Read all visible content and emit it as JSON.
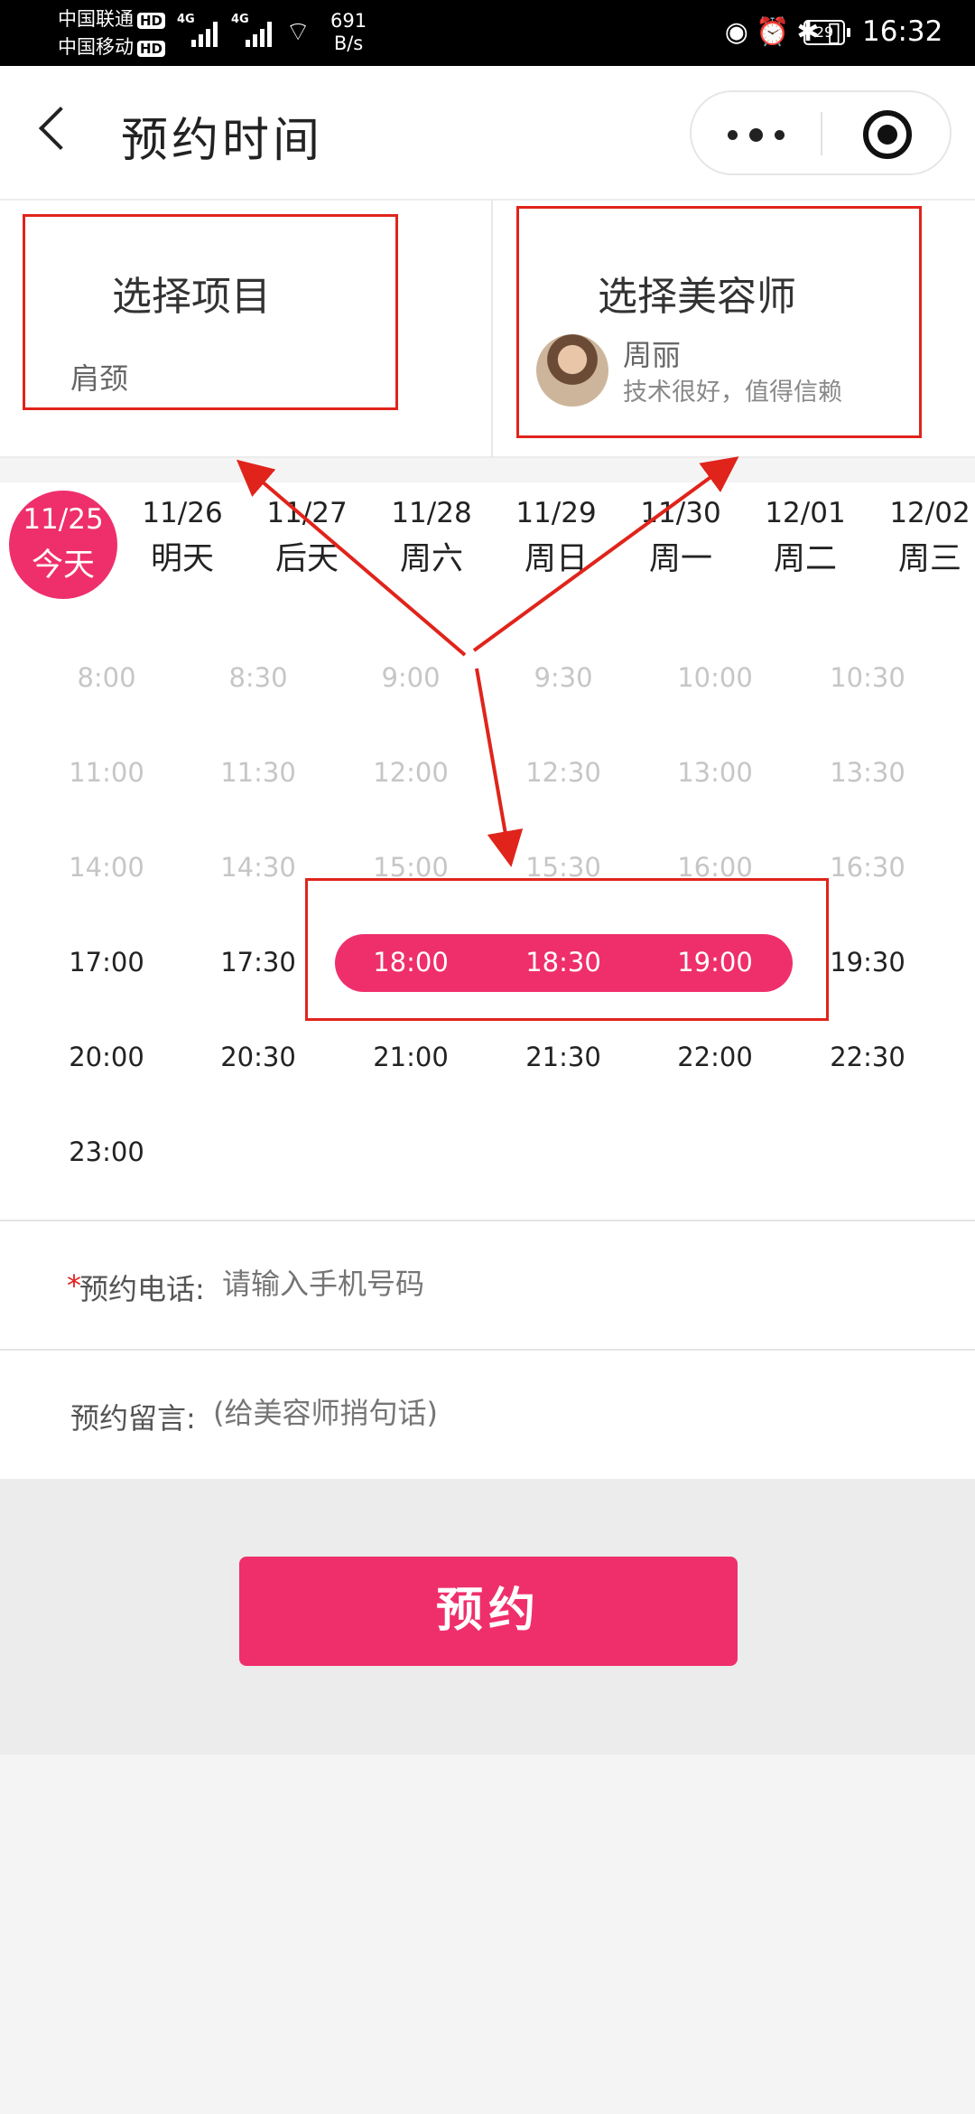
{
  "status_bar": {
    "carrier1": "中国联通",
    "carrier2": "中国移动",
    "hd": "HD",
    "signal_label": "4G",
    "speed_value": "691",
    "speed_unit": "B/s",
    "battery": "29",
    "time": "16:32"
  },
  "nav": {
    "title": "预约时间"
  },
  "cards": {
    "project": {
      "heading": "选择项目",
      "value": "肩颈"
    },
    "stylist": {
      "heading": "选择美容师",
      "name": "周丽",
      "description": "技术很好，值得信赖"
    }
  },
  "dates": [
    {
      "md": "11/25",
      "wd": "今天",
      "active": true
    },
    {
      "md": "11/26",
      "wd": "明天"
    },
    {
      "md": "11/27",
      "wd": "后天"
    },
    {
      "md": "11/28",
      "wd": "周六"
    },
    {
      "md": "11/29",
      "wd": "周日"
    },
    {
      "md": "11/30",
      "wd": "周一"
    },
    {
      "md": "12/01",
      "wd": "周二"
    },
    {
      "md": "12/02",
      "wd": "周三"
    }
  ],
  "time_slots": [
    {
      "time": "8:00",
      "state": "past"
    },
    {
      "time": "8:30",
      "state": "past"
    },
    {
      "time": "9:00",
      "state": "past"
    },
    {
      "time": "9:30",
      "state": "past"
    },
    {
      "time": "10:00",
      "state": "past"
    },
    {
      "time": "10:30",
      "state": "past"
    },
    {
      "time": "11:00",
      "state": "past"
    },
    {
      "time": "11:30",
      "state": "past"
    },
    {
      "time": "12:00",
      "state": "past"
    },
    {
      "time": "12:30",
      "state": "past"
    },
    {
      "time": "13:00",
      "state": "past"
    },
    {
      "time": "13:30",
      "state": "past"
    },
    {
      "time": "14:00",
      "state": "past"
    },
    {
      "time": "14:30",
      "state": "past"
    },
    {
      "time": "15:00",
      "state": "past"
    },
    {
      "time": "15:30",
      "state": "past"
    },
    {
      "time": "16:00",
      "state": "past"
    },
    {
      "time": "16:30",
      "state": "past"
    },
    {
      "time": "17:00",
      "state": "free"
    },
    {
      "time": "17:30",
      "state": "free"
    },
    {
      "time": "18:00",
      "state": "chosen"
    },
    {
      "time": "18:30",
      "state": "chosen"
    },
    {
      "time": "19:00",
      "state": "chosen"
    },
    {
      "time": "19:30",
      "state": "free"
    },
    {
      "time": "20:00",
      "state": "free"
    },
    {
      "time": "20:30",
      "state": "free"
    },
    {
      "time": "21:00",
      "state": "free"
    },
    {
      "time": "21:30",
      "state": "free"
    },
    {
      "time": "22:00",
      "state": "free"
    },
    {
      "time": "22:30",
      "state": "free"
    },
    {
      "time": "23:00",
      "state": "free"
    }
  ],
  "form": {
    "required_mark": "*",
    "phone_label": "预约电话:",
    "phone_placeholder": "请输入手机号码",
    "note_label": "预约留言:",
    "note_placeholder": "(给美容师捎句话)"
  },
  "book_button": "预约",
  "colors": {
    "accent": "#ef2f6c",
    "annotation": "#e0241b"
  }
}
